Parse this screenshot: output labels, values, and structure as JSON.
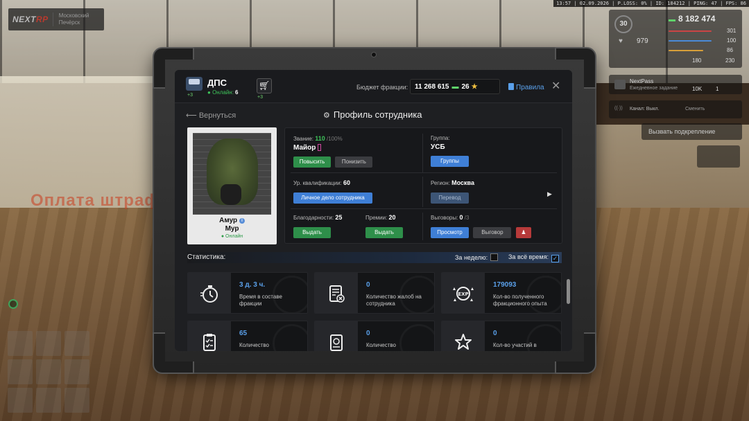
{
  "hud": {
    "logo_left": "NEXT",
    "logo_right": "RP",
    "server_name": "Московский",
    "server_sub": "Печёрск",
    "status_line": "13:57 | 02.09.2026 | P.LOSS: 0% | ID: 184212 | PING: 47 | FPS: 86",
    "level": "30",
    "money": "8 182 474",
    "health": "979",
    "stat_301": "301",
    "stat_100": "100",
    "stat_86": "86",
    "stat_180": "180",
    "stat_230": "230",
    "nextpass_title": "NextPass",
    "nextpass_sub": "Ежедневное задание",
    "nextpass_reward": "10K",
    "nextpass_count": "1",
    "channel_label": "Канал: Выкл.",
    "channel_switch": "Сменить",
    "backup_label": "Вызвать подкрепление",
    "bg_text": "Оплата штрафов"
  },
  "header": {
    "faction_name": "ДПС",
    "online_label": "Онлайн:",
    "online_count": "6",
    "faction_badge": "+3",
    "shop_badge": "+3",
    "budget_label": "Бюджет фракции:",
    "budget_value": "11 268 615",
    "budget_points": "26",
    "rules_label": "Правила"
  },
  "nav": {
    "back_label": "Вернуться",
    "page_title": "Профиль сотрудника"
  },
  "employee": {
    "name_first": "Амур",
    "name_last": "Мур",
    "status": "Онлайн"
  },
  "profile": {
    "rank_label": "Звание:",
    "rank_progress": "110",
    "rank_progress_max": "/100%",
    "rank_value": "Майор",
    "promote_label": "Повысить",
    "demote_label": "Понизить",
    "group_label": "Группа:",
    "group_value": "УСБ",
    "groups_button": "Группы",
    "qualification_label": "Ур. квалификации:",
    "qualification_value": "60",
    "file_button": "Личное дело сотрудника",
    "region_label": "Регион:",
    "region_value": "Москва",
    "transfer_button": "Перевод",
    "thanks_label": "Благодарности:",
    "thanks_value": "25",
    "thanks_button": "Выдать",
    "bonus_label": "Премии:",
    "bonus_value": "20",
    "bonus_button": "Выдать",
    "reprimand_label": "Выговоры:",
    "reprimand_value": "0",
    "reprimand_max": "/3",
    "view_button": "Просмотр",
    "reprimand_button": "Выговор"
  },
  "stats": {
    "title": "Статистика:",
    "week_label": "За неделю:",
    "all_time_label": "За всё время:",
    "cards": [
      {
        "value": "3 д. 3 ч.",
        "label": "Время в составе фракции",
        "icon": "stopwatch-icon"
      },
      {
        "value": "0",
        "label": "Количество жалоб на сотрудника",
        "icon": "complaint-icon"
      },
      {
        "value": "179093",
        "label": "Кол-во полученного фракционного опыта",
        "icon": "exp-icon"
      },
      {
        "value": "65",
        "label": "Количество",
        "icon": "clipboard-icon"
      },
      {
        "value": "0",
        "label": "Количество",
        "icon": "document-coin-icon"
      },
      {
        "value": "0",
        "label": "Кол-во участий в",
        "icon": "star-icon"
      }
    ]
  },
  "colors": {
    "accent_blue": "#3f7fd6",
    "accent_green": "#2e8f4a",
    "online_green": "#3ec45a",
    "danger_red": "#b73a3a"
  }
}
